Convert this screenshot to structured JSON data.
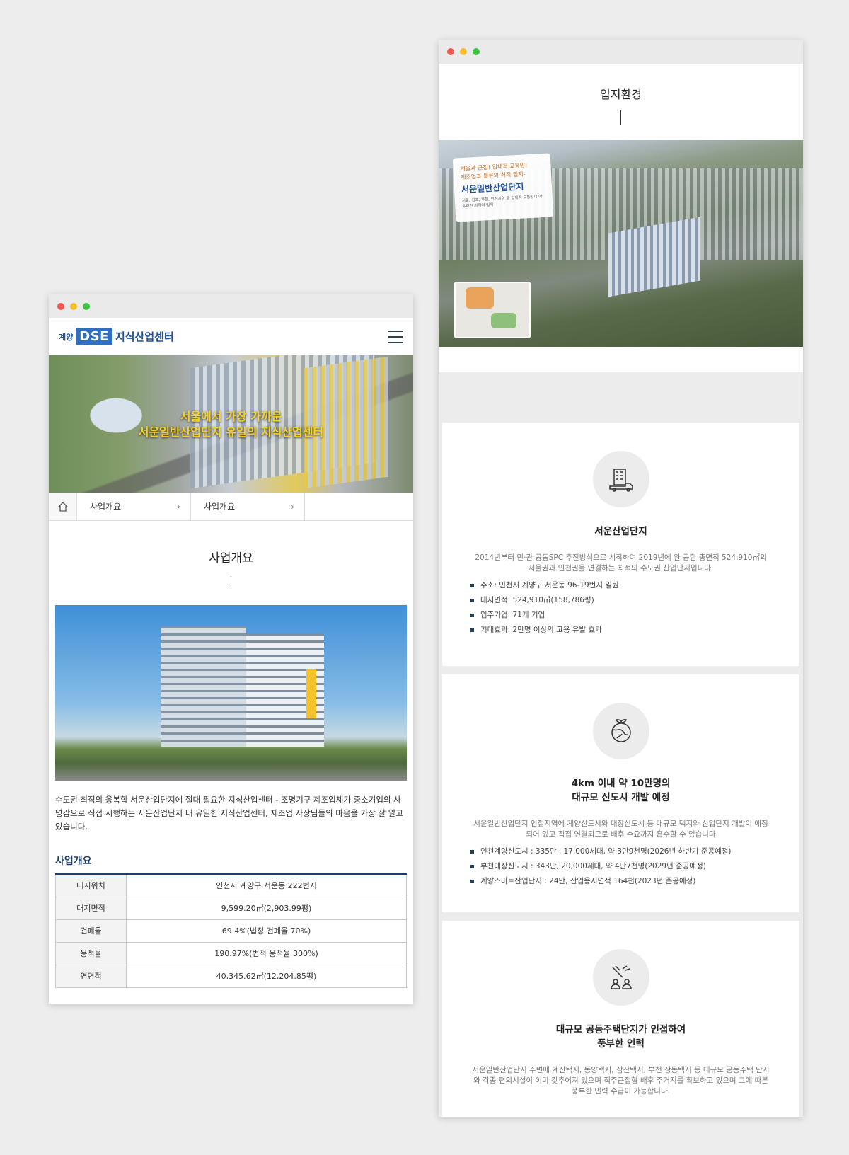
{
  "left_window": {
    "logo": {
      "prefix": "계양",
      "brand": "DSE",
      "name": "지식산업센터"
    },
    "hero": {
      "line1": "서울에서 가장 가까운",
      "line2": "서운일반산업단지 유일의 지식산업센터"
    },
    "breadcrumb": {
      "items": [
        "사업개요",
        "사업개요"
      ]
    },
    "section_title": "사업개요",
    "intro": "수도권 최적의 융복합 서운산업단지에 절대 필요한 지식산업센터 - 조명기구 제조업체가 중소기업의 사명감으로 직접 시행하는 서운산업단지 내 유일한 지식산업센터, 제조업 사장님들의 마음을 가장 잘 알고 있습니다.",
    "table_title": "사업개요",
    "table": [
      {
        "label": "대지위치",
        "value": "인천시 계양구 서운동 222번지"
      },
      {
        "label": "대지면적",
        "value": "9,599.20㎡(2,903.99평)"
      },
      {
        "label": "건폐율",
        "value": "69.4%(법정 건폐율 70%)"
      },
      {
        "label": "용적율",
        "value": "190.97%(법적 용적율 300%)"
      },
      {
        "label": "연면적",
        "value": "40,345.62㎡(12,204.85평)"
      }
    ]
  },
  "right_window": {
    "section_title": "입지환경",
    "callout": {
      "line1": "서울과 근접! 입체적 교통망!",
      "line2": "제조업과 물류의 최적 입지-",
      "title": "서운일반산업단지",
      "desc": "서울, 김포, 부천, 인천공항 등 입체적 교통망이 어우러진 최적의 입지"
    },
    "cards": [
      {
        "icon": "factory-truck-icon",
        "title1": "서운산업단지",
        "title2": "",
        "desc": "2014년부터 민·관 공동SPC 추진방식으로 시작하여 2019년에 완 공한 총면적 524,910㎡의 서울권과 인천권을 연결하는 최적의 수도권 산업단지입니다.",
        "items": [
          "주소: 인천시 계양구 서운동 96-19번지 일원",
          "대지면적: 524,910㎡(158,786평)",
          "입주기업: 71개 기업",
          "기대효과: 2만명 이상의 고용 유발 효과"
        ]
      },
      {
        "icon": "globe-plant-icon",
        "title1": "4km 이내 약 10만명의",
        "title2": "대규모 신도시 개발 예정",
        "desc": "서운일반산업단지 인접지역에 계양신도시와 대장신도시 등 대규모 택지와 산업단지 개발이 예정되어 있고 직접 연결되므로 배후 수요까지 흡수할 수 있습니다",
        "items": [
          "인천계양신도시 : 335만 , 17,000세대, 약 3만9천명(2026년 하반기 준공예정)",
          "부천대장신도시 : 343만, 20,000세대, 약 4만7천명(2029년 준공예정)",
          "계양스마트산업단지 : 24만, 산업용지면적 164천(2023년 준공예정)"
        ]
      },
      {
        "icon": "workforce-icon",
        "title1": "대규모 공동주택단지가 인접하여",
        "title2": "풍부한 인력",
        "desc": "서운일반산업단지 주변에 계산택지, 동양택지, 삼산택지, 부천 상동택지 등 대규모 공동주택 단지와 각종 편의시설이 이미 갖추어져 있으며 직주근접형 배후 주거지를 확보하고 있으며 그에 따른 풍부한 인력 수급이 가능합니다.",
        "items": []
      }
    ]
  },
  "colors": {
    "brand_blue": "#2f6fc0",
    "navy": "#1d3f6e",
    "hero_yellow": "#f7d12b"
  }
}
